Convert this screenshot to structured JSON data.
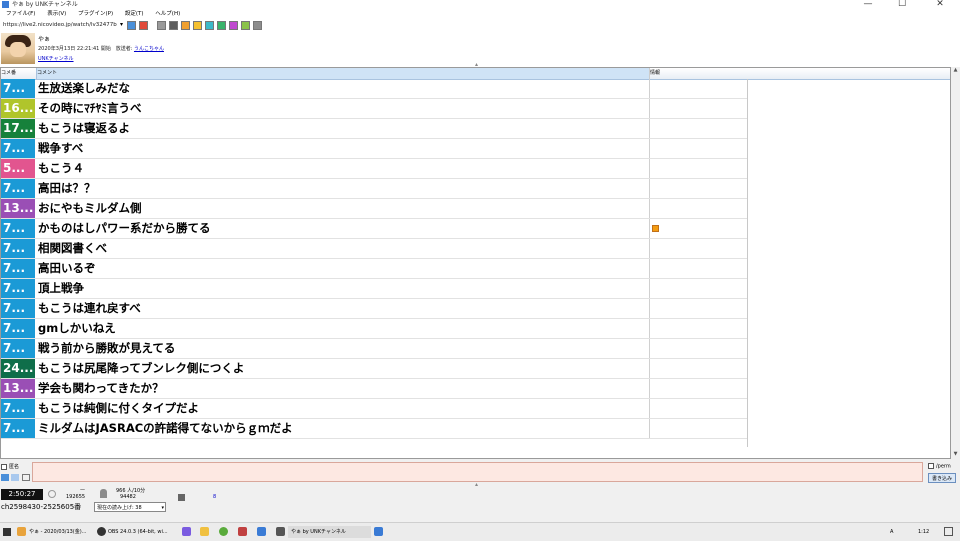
{
  "window": {
    "title": "やぁ by UNKチャンネル",
    "controls": {
      "minimize": "—",
      "maximize": "☐",
      "close": "✕"
    }
  },
  "menu": [
    "ファイル(F)",
    "表示(V)",
    "プラグイン(P)",
    "設定(T)",
    "ヘルプ(H)"
  ],
  "url": {
    "value": "https://live2.nicovideo.jp/watch/lv32477b",
    "dropdown": "▾"
  },
  "stream": {
    "title": "やぁ",
    "started": "2020年3月13日 22:21:41 開始",
    "broadcaster_label": "放送者:",
    "broadcaster": "うんこちゃん",
    "channel": "UNKチャンネル"
  },
  "list": {
    "headers": {
      "no": "コメ番",
      "comment": "コメント",
      "info": "情報"
    },
    "rows": [
      {
        "num": "7...",
        "text": "生放送楽しみだな",
        "color": "#1b9ad6",
        "marker": false
      },
      {
        "num": "16...",
        "text": "その時にﾏﾁﾔﾐ言うべ",
        "color": "#b0c52b",
        "marker": false
      },
      {
        "num": "17...",
        "text": "もこうは寝返るよ",
        "color": "#16813b",
        "marker": false
      },
      {
        "num": "7...",
        "text": "戦争すべ",
        "color": "#1b9ad6",
        "marker": false
      },
      {
        "num": "5...",
        "text": "もこう４",
        "color": "#e2558f",
        "marker": false
      },
      {
        "num": "7...",
        "text": "高田は？？",
        "color": "#1b9ad6",
        "marker": false
      },
      {
        "num": "13...",
        "text": "おにやもミルダム側",
        "color": "#9a4fb5",
        "marker": false
      },
      {
        "num": "7...",
        "text": "かものはしパワー系だから勝てる",
        "color": "#1b9ad6",
        "marker": true
      },
      {
        "num": "7...",
        "text": "相関図書くべ",
        "color": "#1b9ad6",
        "marker": false
      },
      {
        "num": "7...",
        "text": "高田いるぞ",
        "color": "#1b9ad6",
        "marker": false
      },
      {
        "num": "7...",
        "text": "頂上戦争",
        "color": "#1b9ad6",
        "marker": false
      },
      {
        "num": "7...",
        "text": "もこうは連れ戻すべ",
        "color": "#1b9ad6",
        "marker": false
      },
      {
        "num": "7...",
        "text": "gmしかいねえ",
        "color": "#1b9ad6",
        "marker": false
      },
      {
        "num": "7...",
        "text": "戦う前から勝敗が見えてる",
        "color": "#1b9ad6",
        "marker": false
      },
      {
        "num": "24...",
        "text": "もこうは尻尾降ってブンレク側につくよ",
        "color": "#0f6e4a",
        "marker": false
      },
      {
        "num": "13...",
        "text": "学会も関わってきたか？",
        "color": "#9a4fb5",
        "marker": false
      },
      {
        "num": "7...",
        "text": "もこうは純側に付くタイプだよ",
        "color": "#1b9ad6",
        "marker": false
      },
      {
        "num": "7...",
        "text": "ミルダムはJASRACの許諾得てないからｇｍだよ",
        "color": "#1b9ad6",
        "marker": false
      }
    ]
  },
  "bottom": {
    "anon_label": "匿名",
    "perm_label": "/perm",
    "post_label": "書き込み",
    "clock": "2:50:27",
    "range": "ch2598430-2525605番",
    "stat1_top": "—",
    "stat1_value": "192655",
    "stat2_top": "966 人/10分",
    "stat2_value": "94482",
    "stat3_value": "8",
    "speed_label": "現在の読み上げ: 38",
    "speed_dd": "▾"
  },
  "taskbar": {
    "items": [
      "やぁ - 2020/03/13(金)...",
      "OBS 24.0.3 (64-bit, wi...",
      "やぁ by UNKチャンネル"
    ],
    "time": "1:12",
    "ime": "A"
  }
}
